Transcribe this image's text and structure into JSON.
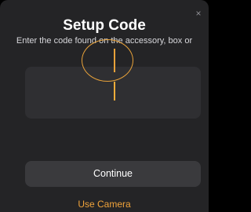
{
  "dialog": {
    "title": "Setup Code",
    "subtitle": "Enter the code found on the accessory, box or",
    "close_glyph": "×"
  },
  "code_field": {
    "value": ""
  },
  "actions": {
    "continue_label": "Continue",
    "camera_label": "Use Camera"
  },
  "colors": {
    "background": "#242426",
    "field": "#2f2f32",
    "button": "#3a3a3d",
    "accent": "#f0a33a",
    "text": "#ffffff"
  },
  "icons": {
    "close": "close-icon"
  }
}
